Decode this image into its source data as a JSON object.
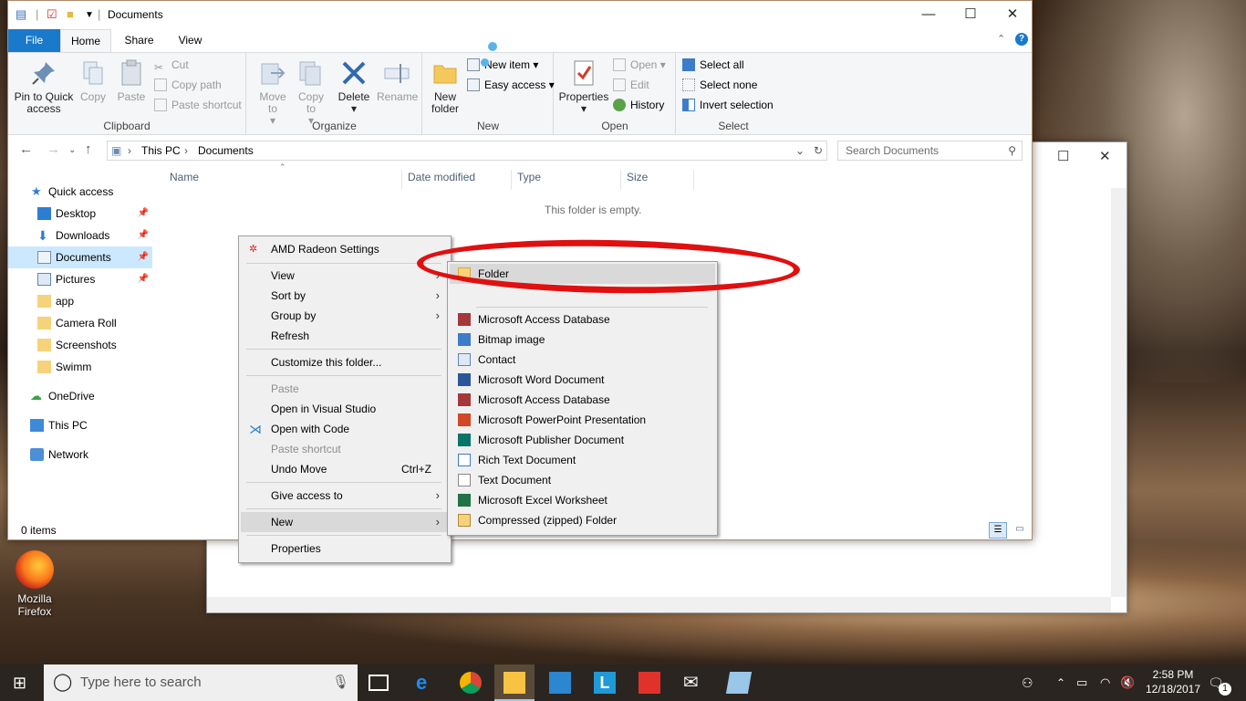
{
  "window": {
    "title": "Documents",
    "tabs": [
      "File",
      "Home",
      "Share",
      "View"
    ]
  },
  "ribbon": {
    "clipboard": {
      "label": "Clipboard",
      "pin": "Pin to Quick access",
      "copy": "Copy",
      "paste": "Paste",
      "cut": "Cut",
      "copy_path": "Copy path",
      "paste_shortcut": "Paste shortcut"
    },
    "organize": {
      "label": "Organize",
      "move_to": "Move to",
      "copy_to": "Copy to",
      "delete": "Delete",
      "rename": "Rename"
    },
    "new": {
      "label": "New",
      "new_folder": "New folder",
      "new_item": "New item",
      "easy_access": "Easy access"
    },
    "open": {
      "label": "Open",
      "properties": "Properties",
      "open": "Open",
      "edit": "Edit",
      "history": "History"
    },
    "select": {
      "label": "Select",
      "select_all": "Select all",
      "select_none": "Select none",
      "invert": "Invert selection"
    }
  },
  "address": {
    "path": [
      "This PC",
      "Documents"
    ],
    "search_placeholder": "Search Documents"
  },
  "nav": {
    "items": [
      {
        "label": "Quick access"
      },
      {
        "label": "Desktop"
      },
      {
        "label": "Downloads"
      },
      {
        "label": "Documents"
      },
      {
        "label": "Pictures"
      },
      {
        "label": "app"
      },
      {
        "label": "Camera Roll"
      },
      {
        "label": "Screenshots"
      },
      {
        "label": "Swimm"
      },
      {
        "label": "OneDrive"
      },
      {
        "label": "This PC"
      },
      {
        "label": "Network"
      }
    ]
  },
  "columns": [
    "Name",
    "Date modified",
    "Type",
    "Size"
  ],
  "empty_message": "This folder is empty.",
  "status": "0 items",
  "context_menu": {
    "items": [
      "AMD Radeon Settings",
      "View",
      "Sort by",
      "Group by",
      "Refresh",
      "Customize this folder...",
      "Paste",
      "Open in Visual Studio",
      "Open with Code",
      "Paste shortcut",
      "Undo Move",
      "Give access to",
      "New",
      "Properties"
    ],
    "undo_shortcut": "Ctrl+Z"
  },
  "new_submenu": {
    "items": [
      "Folder",
      "Microsoft Access Database",
      "Bitmap image",
      "Contact",
      "Microsoft Word Document",
      "Microsoft Access Database",
      "Microsoft PowerPoint Presentation",
      "Microsoft Publisher Document",
      "Rich Text Document",
      "Text Document",
      "Microsoft Excel Worksheet",
      "Compressed (zipped) Folder"
    ]
  },
  "desktop": {
    "firefox_label": "Mozilla Firefox"
  },
  "taskbar": {
    "search_placeholder": "Type here to search",
    "time": "2:58 PM",
    "date": "12/18/2017",
    "notification_count": "1"
  },
  "colors": {
    "accent": "#1979ca",
    "selection": "#cce8ff",
    "annotation": "#e01010"
  }
}
